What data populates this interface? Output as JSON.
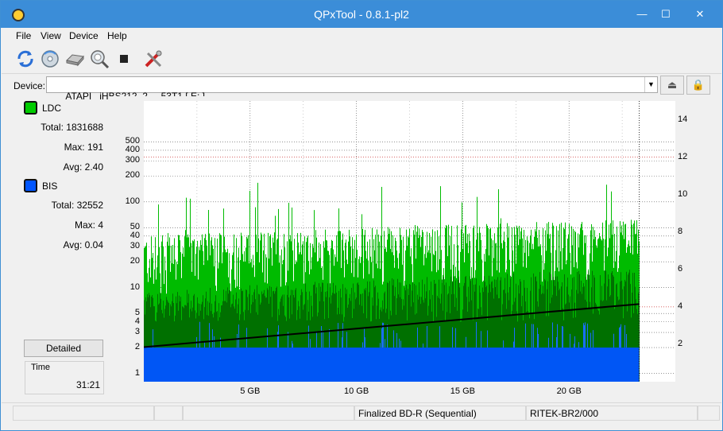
{
  "window": {
    "title": "QPxTool - 0.8.1-pl2"
  },
  "menu": [
    "File",
    "View",
    "Device",
    "Help"
  ],
  "toolbar_icons": [
    "refresh-icon",
    "disc-info-icon",
    "drive-icon",
    "scan-icon",
    "stop-icon",
    "tools-icon"
  ],
  "device": {
    "label": "Device:",
    "value": "ATAPI   iHBS212  2     53T1 [ E: ]"
  },
  "legend": {
    "ldc": {
      "name": "LDC",
      "color": "#00cc00",
      "total_label": "Total:",
      "total": "1831688",
      "max_label": "Max:",
      "max": "191",
      "avg_label": "Avg:",
      "avg": "2.40"
    },
    "bis": {
      "name": "BIS",
      "color": "#0055ff",
      "total_label": "Total:",
      "total": "32552",
      "max_label": "Max:",
      "max": "4",
      "avg_label": "Avg:",
      "avg": "0.04"
    }
  },
  "detailed_label": "Detailed",
  "time": {
    "label": "Time",
    "value": "31:21"
  },
  "status": [
    "",
    "",
    "Finalized BD-R (Sequential)",
    "RITEK-BR2/000",
    ""
  ],
  "chart_data": {
    "type": "bar",
    "y_scale": "log",
    "y_left_ticks": [
      "1",
      "2",
      "3",
      "4",
      "5",
      "10",
      "20",
      "30",
      "40",
      "50",
      "100",
      "200",
      "300",
      "400",
      "500"
    ],
    "y_right_ticks": [
      "2",
      "4",
      "6",
      "8",
      "10",
      "12",
      "14"
    ],
    "x_ticks": [
      "5 GB",
      "10 GB",
      "15 GB",
      "20 GB"
    ],
    "x_tick_values_gb": [
      5,
      10,
      15,
      20
    ],
    "x_range_gb": [
      0,
      25
    ],
    "data_end_gb": 23.3,
    "series": [
      {
        "name": "LDC",
        "color": "#00bb00",
        "typical_range": [
          8,
          40
        ],
        "peak_max": 191
      },
      {
        "name": "BIS",
        "color": "#0055ff",
        "typical": 2,
        "max": 4
      },
      {
        "name": "speed",
        "color": "#000000",
        "start": 1.85,
        "end": 4.15
      }
    ]
  }
}
